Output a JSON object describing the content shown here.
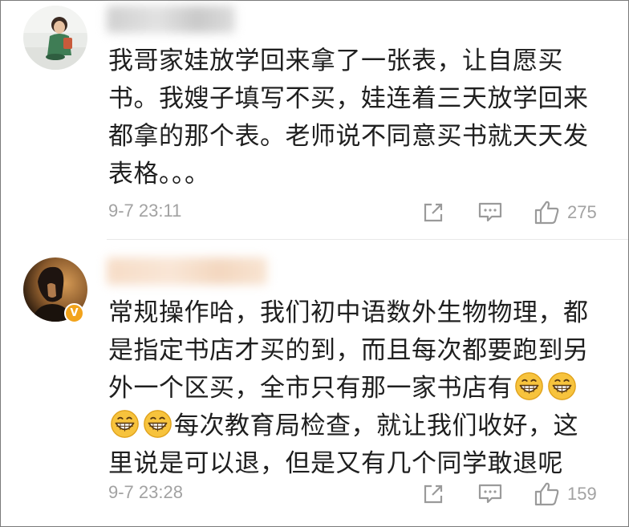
{
  "comments": [
    {
      "username": "",
      "verified": false,
      "text_lines": [
        "我哥家娃放学回来拿了一张表，让自愿买",
        "书。我嫂子填写不买，娃连着三天放学回来",
        "都拿的那个表。老师说不同意买书就天天发",
        "表格。。。"
      ],
      "timestamp": "9-7 23:11",
      "likes": "275",
      "icons": {
        "share": "share-icon",
        "comment": "comment-icon",
        "like": "thumbs-up-icon"
      }
    },
    {
      "username": "",
      "verified": true,
      "verified_badge": "V",
      "text_parts": {
        "line1": "常规操作哈，我们初中语数外生物物理，都",
        "line2": "是指定书店才买的到，而且每次都要跑到另",
        "line3": "外一个区买，全市只有那一家书店有",
        "line4": "每次教育局检查，就让我们收好，这",
        "line5": "里说是可以退，但是又有几个同学敢退呢"
      },
      "emoji": "grinning-face-emoji",
      "timestamp": "9-7 23:28",
      "likes": "159",
      "icons": {
        "share": "share-icon",
        "comment": "comment-icon",
        "like": "thumbs-up-icon"
      }
    }
  ],
  "colors": {
    "text": "#1f1f1f",
    "meta": "#a2a2a2",
    "verified_badge": "#f2a31b",
    "border": "#7a7a7a"
  }
}
